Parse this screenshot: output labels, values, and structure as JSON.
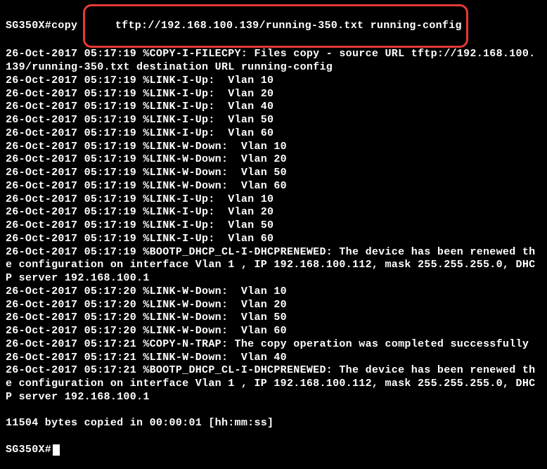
{
  "prompt1": "SG350X#copy ",
  "command": "tftp://192.168.100.139/running-350.txt running-config",
  "log": [
    "26-Oct-2017 05:17:19 %COPY-I-FILECPY: Files copy - source URL tftp://192.168.100.139/running-350.txt destination URL running-config",
    "26-Oct-2017 05:17:19 %LINK-I-Up:  Vlan 10",
    "26-Oct-2017 05:17:19 %LINK-I-Up:  Vlan 20",
    "26-Oct-2017 05:17:19 %LINK-I-Up:  Vlan 40",
    "26-Oct-2017 05:17:19 %LINK-I-Up:  Vlan 50",
    "26-Oct-2017 05:17:19 %LINK-I-Up:  Vlan 60",
    "26-Oct-2017 05:17:19 %LINK-W-Down:  Vlan 10",
    "26-Oct-2017 05:17:19 %LINK-W-Down:  Vlan 20",
    "26-Oct-2017 05:17:19 %LINK-W-Down:  Vlan 50",
    "26-Oct-2017 05:17:19 %LINK-W-Down:  Vlan 60",
    "26-Oct-2017 05:17:19 %LINK-I-Up:  Vlan 10",
    "26-Oct-2017 05:17:19 %LINK-I-Up:  Vlan 20",
    "26-Oct-2017 05:17:19 %LINK-I-Up:  Vlan 50",
    "26-Oct-2017 05:17:19 %LINK-I-Up:  Vlan 60",
    "26-Oct-2017 05:17:19 %BOOTP_DHCP_CL-I-DHCPRENEWED: The device has been renewed the configuration on interface Vlan 1 , IP 192.168.100.112, mask 255.255.255.0, DHCP server 192.168.100.1",
    "26-Oct-2017 05:17:20 %LINK-W-Down:  Vlan 10",
    "26-Oct-2017 05:17:20 %LINK-W-Down:  Vlan 20",
    "26-Oct-2017 05:17:20 %LINK-W-Down:  Vlan 50",
    "26-Oct-2017 05:17:20 %LINK-W-Down:  Vlan 60",
    "26-Oct-2017 05:17:21 %COPY-N-TRAP: The copy operation was completed successfully",
    "26-Oct-2017 05:17:21 %LINK-W-Down:  Vlan 40",
    "26-Oct-2017 05:17:21 %BOOTP_DHCP_CL-I-DHCPRENEWED: The device has been renewed the configuration on interface Vlan 1 , IP 192.168.100.112, mask 255.255.255.0, DHCP server 192.168.100.1",
    "",
    "11504 bytes copied in 00:00:01 [hh:mm:ss]",
    ""
  ],
  "prompt2": "SG350X#"
}
